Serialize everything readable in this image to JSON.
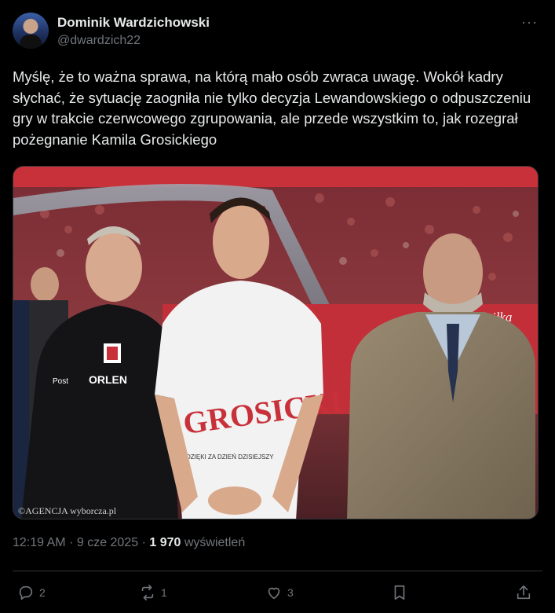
{
  "author": {
    "name": "Dominik Wardzichowski",
    "handle": "@dwardzich22"
  },
  "tweet": {
    "text": "Myślę, że to ważna sprawa, na którą mało osób zwraca uwagę. Wokół kadry słychać, że sytuację zaogniła nie tylko decyzja Lewandowskiego o odpuszczeniu gry w trakcie czerwcowego zgrupowania, ale przede wszystkim to, jak rozegrał pożegnanie Kamila Grosickiego"
  },
  "image": {
    "shirt_text": "GROSICKI",
    "shirt_subtext": "DZIĘKI ZA DZIEŃ DZISIEJSZY",
    "sponsor": "ORLEN",
    "sponsor2": "Post",
    "banner_text": "as piłka",
    "watermark": "©AGENCJA wyborcza.pl"
  },
  "meta": {
    "time": "12:19 AM",
    "sep": "·",
    "date": "9 cze 2025",
    "views_count": "1 970",
    "views_label": "wyświetleń"
  },
  "actions": {
    "replies": "2",
    "reposts": "1",
    "likes": "3"
  },
  "colors": {
    "background": "#000000",
    "text": "#e7e9ea",
    "muted": "#71767b",
    "divider": "#2f3336"
  }
}
